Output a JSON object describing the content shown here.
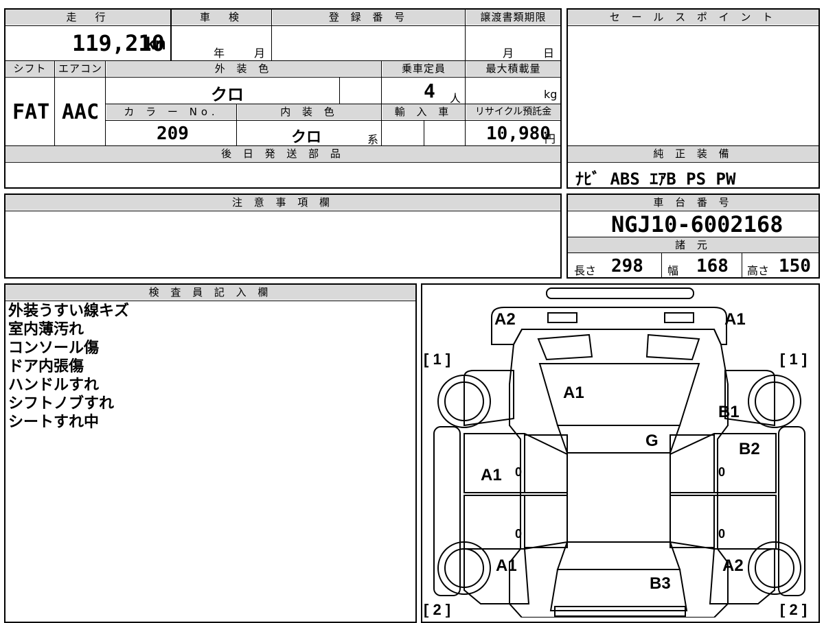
{
  "top": {
    "mileage_label": "走　行",
    "mileage_value": "119,210",
    "mileage_unit": "km",
    "shaken_label": "車　検",
    "shaken_year": "年",
    "shaken_month": "月",
    "reg_label": "登 録 番 号",
    "transfer_label": "譲渡書類期限",
    "transfer_month": "月",
    "transfer_day": "日"
  },
  "sales_point": {
    "label": "セ ー ル ス ポ イ ン ト"
  },
  "specs": {
    "shift_label": "シフト",
    "shift_value": "FAT",
    "aircon_label": "エアコン",
    "aircon_value": "AAC",
    "ext_color_label": "外 装 色",
    "ext_color_value": "クロ",
    "capacity_label": "乗車定員",
    "capacity_value": "4",
    "capacity_unit": "人",
    "max_load_label": "最大積載量",
    "max_load_unit": "kg",
    "color_no_label": "カ ラ ー No.",
    "color_no_value": "209",
    "int_color_label": "内 装 色",
    "int_color_value": "クロ",
    "int_color_suffix": "系",
    "import_label": "輸 入 車",
    "recycle_label": "リサイクル預託金",
    "recycle_value": "10,980",
    "recycle_unit": "円"
  },
  "later_parts": {
    "label": "後 日 発 送 部 品"
  },
  "equipment": {
    "label": "純 正 装 備",
    "value": "ﾅﾋﾞ ABS ｴｱB PS PW"
  },
  "notes": {
    "label": "注 意 事 項 欄"
  },
  "chassis": {
    "label": "車 台 番 号",
    "value": "NGJ10-6002168"
  },
  "dimensions": {
    "label": "諸 元",
    "length_label": "長さ",
    "length_value": "298",
    "width_label": "幅",
    "width_value": "168",
    "height_label": "高さ",
    "height_value": "150"
  },
  "inspector": {
    "label": "検 査 員 記 入 欄",
    "lines": [
      "外装うすい線キズ",
      "室内薄汚れ",
      "コンソール傷",
      "ドア内張傷",
      "ハンドルすれ",
      "シフトノブすれ",
      "シートすれ中"
    ]
  },
  "diagram": {
    "marks": {
      "A2_top_left": "A2",
      "A1_top_right": "A1",
      "bracket_tl": "[ 1 ]",
      "bracket_tr": "[ 1 ]",
      "bracket_bl": "[ 2 ]",
      "bracket_br": "[ 2 ]",
      "hood": "A1",
      "front_right_fender": "B1",
      "windshield": "G",
      "right_front_door": "B2",
      "left_front_door": "A1",
      "left_rear_quarter": "A1",
      "right_rear_quarter": "A2",
      "rear_gate": "B3",
      "zero_lf": "0",
      "zero_rf": "0",
      "zero_lr": "0",
      "zero_rr": "0"
    }
  }
}
